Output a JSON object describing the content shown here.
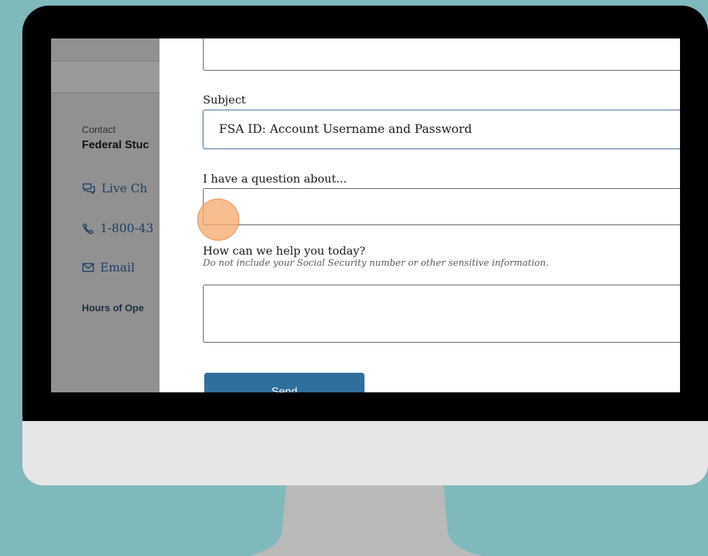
{
  "colors": {
    "background": "#7fb9bc",
    "bezel": "#000000",
    "chin": "#e6e6e6",
    "stand": "#b9b9b9",
    "sidebar": "#919191",
    "link": "#1d3f66",
    "send_button": "#2f6f9d",
    "cursor_highlight": "#f6aa70"
  },
  "sidebar": {
    "contact_label": "Contact",
    "org_name": "Federal Stuc",
    "links": [
      {
        "label": "Live Ch",
        "icon": "chat-bubbles-icon"
      },
      {
        "label": "1-800-43",
        "icon": "phone-icon"
      },
      {
        "label": "Email",
        "icon": "envelope-icon"
      }
    ],
    "hours_label": "Hours of Ope"
  },
  "form": {
    "top_field_value": "",
    "subject_label": "Subject",
    "subject_value": "FSA ID: Account Username and Password",
    "question_label": "I have a question about...",
    "question_value": "",
    "help_label": "How can we help you today?",
    "help_hint": "Do not include your Social Security number or other sensitive information.",
    "help_value": "",
    "send_label": "Send"
  }
}
